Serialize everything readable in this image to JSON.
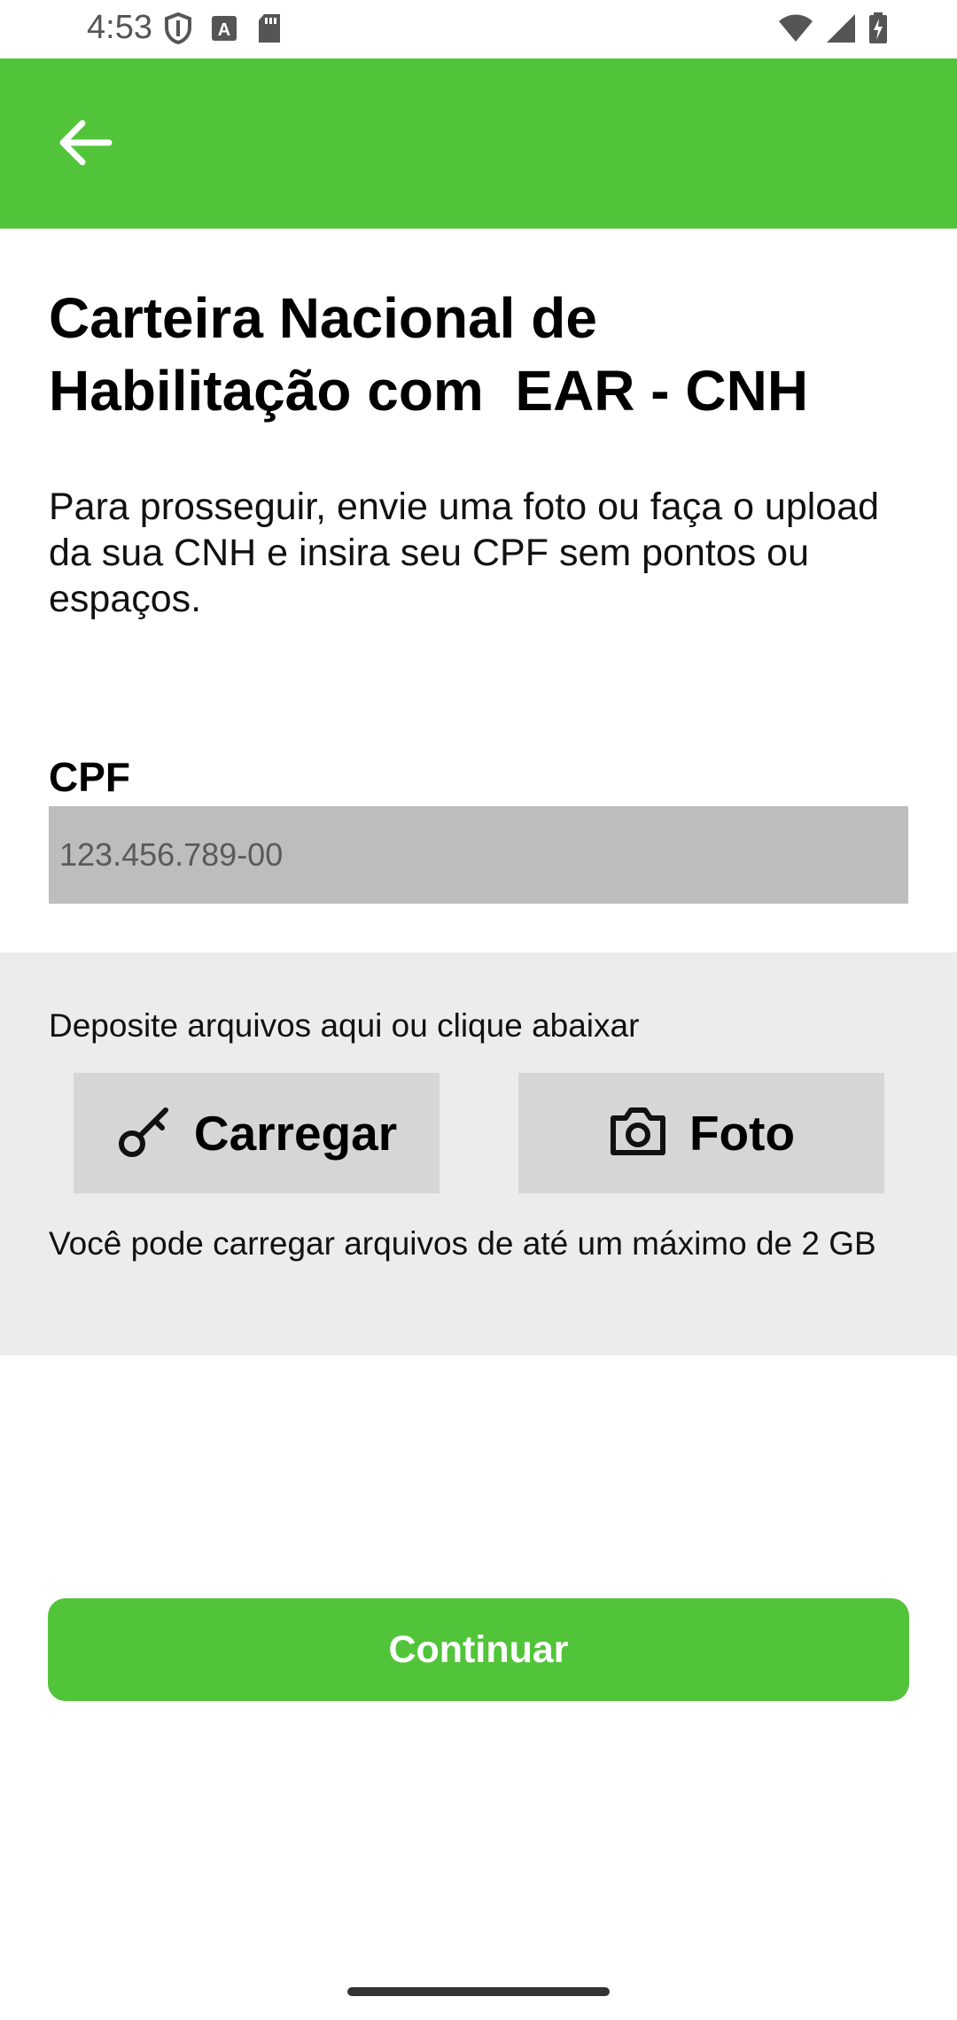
{
  "status_bar": {
    "time": "4:53",
    "icons_left": [
      "shield-icon",
      "font-a-icon",
      "sd-card-icon"
    ],
    "icons_right": [
      "wifi-icon",
      "cell-signal-icon",
      "battery-charging-icon"
    ]
  },
  "app_bar": {
    "back_icon": "arrow-back-icon",
    "color": "#52c43a"
  },
  "page": {
    "title": "Carteira Nacional de\nHabilitação com  EAR - CNH",
    "description": "Para prosseguir, envie uma foto ou faça o upload da sua CNH e insira seu CPF sem pontos ou espaços."
  },
  "cpf": {
    "label": "CPF",
    "placeholder": "123.456.789-00",
    "value": ""
  },
  "upload": {
    "drop_text": "Deposite arquivos aqui ou clique abaixar",
    "carregar_label": "Carregar",
    "carregar_icon": "key-icon",
    "foto_label": "Foto",
    "foto_icon": "camera-icon",
    "limit_text": "Você pode carregar arquivos de até um máximo de 2 GB"
  },
  "actions": {
    "continue_label": "Continuar",
    "color": "#52c43a"
  }
}
